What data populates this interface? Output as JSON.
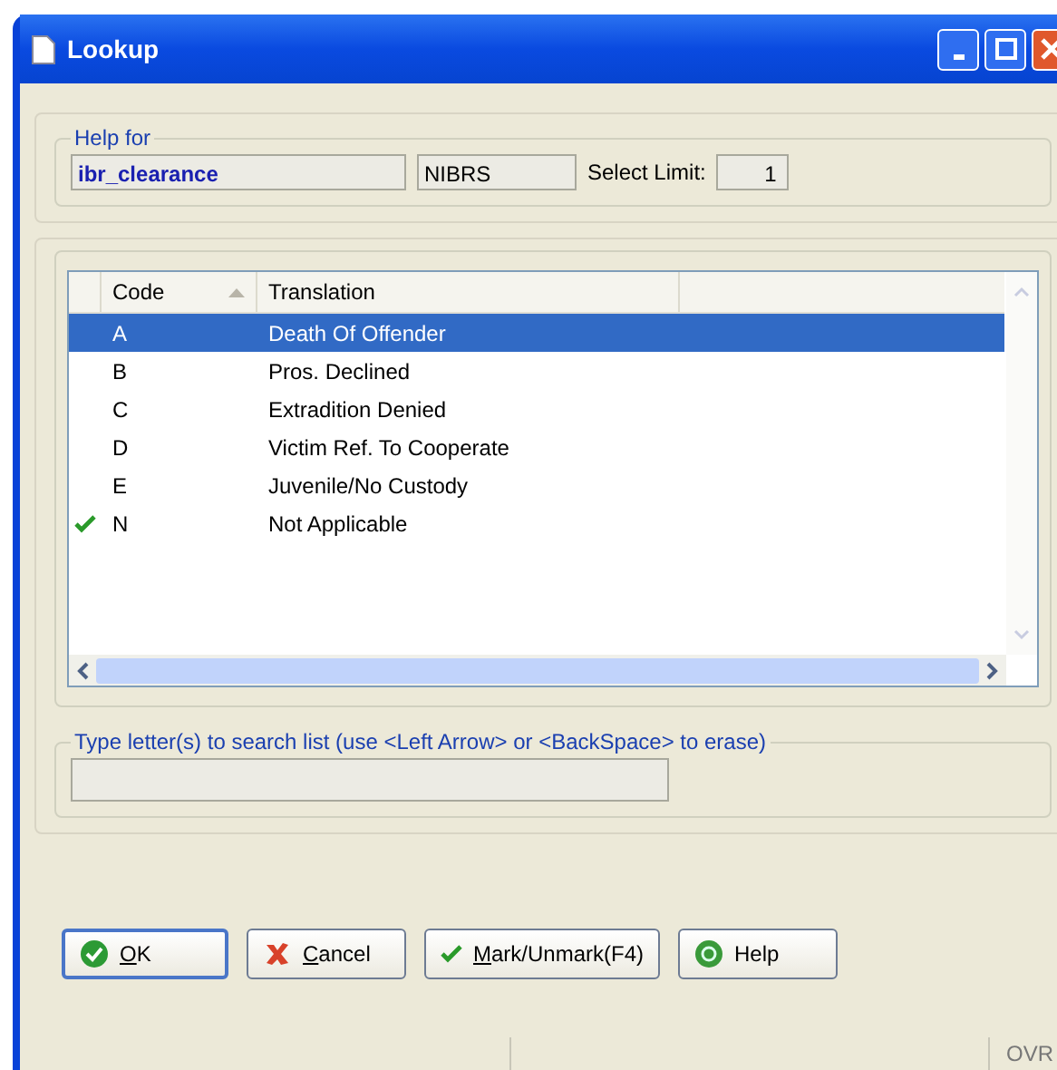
{
  "window": {
    "title": "Lookup"
  },
  "help_for": {
    "legend": "Help for",
    "field": "ibr_clearance",
    "system": "NIBRS",
    "limit_label": "Select Limit:",
    "limit": "1"
  },
  "list": {
    "columns": [
      {
        "label": "Code",
        "sorted": true
      },
      {
        "label": "Translation",
        "sorted": false
      }
    ],
    "rows": [
      {
        "code": "A",
        "translation": "Death Of Offender",
        "selected": true,
        "marked": false
      },
      {
        "code": "B",
        "translation": "Pros. Declined",
        "selected": false,
        "marked": false
      },
      {
        "code": "C",
        "translation": "Extradition Denied",
        "selected": false,
        "marked": false
      },
      {
        "code": "D",
        "translation": "Victim Ref. To Cooperate",
        "selected": false,
        "marked": false
      },
      {
        "code": "E",
        "translation": "Juvenile/No Custody",
        "selected": false,
        "marked": false
      },
      {
        "code": "N",
        "translation": "Not Applicable",
        "selected": false,
        "marked": true
      }
    ]
  },
  "search": {
    "legend": "Type letter(s) to search list (use <Left Arrow> or <BackSpace> to erase)"
  },
  "buttons": [
    {
      "kind": "ok",
      "accel": "O",
      "rest": "K",
      "default": true
    },
    {
      "kind": "cancel",
      "accel": "C",
      "rest": "ancel",
      "default": false
    },
    {
      "kind": "mark",
      "accel": "M",
      "rest": "ark/Unmark(F4)",
      "default": false
    },
    {
      "kind": "help",
      "rest": "Help",
      "default": false
    }
  ],
  "status_bar": {
    "mode": "OVR"
  }
}
